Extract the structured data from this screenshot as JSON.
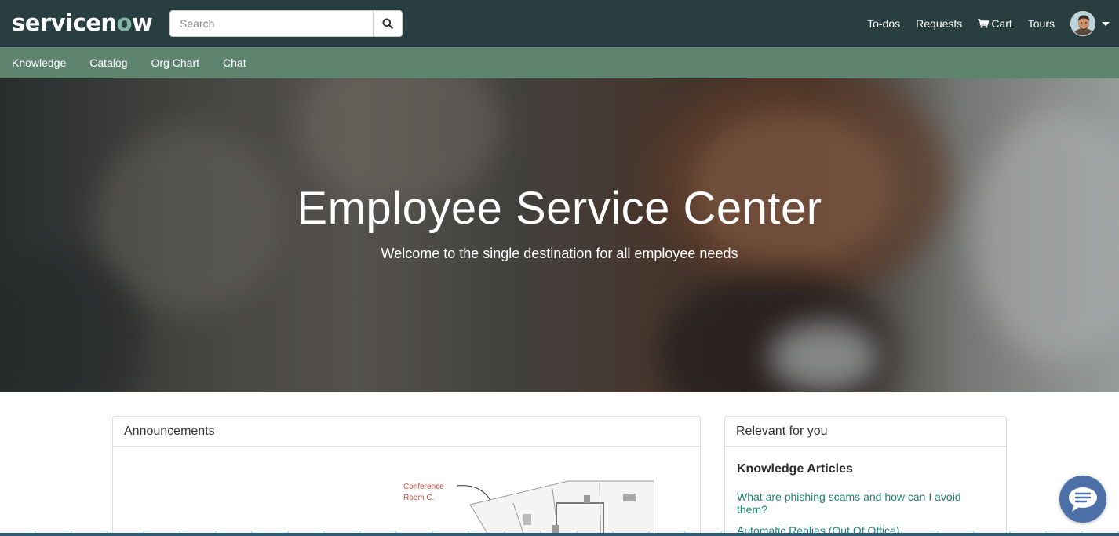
{
  "header": {
    "logo_prefix": "servicen",
    "logo_o": "o",
    "logo_suffix": "w",
    "search": {
      "placeholder": "Search",
      "value": ""
    },
    "links": {
      "todos": "To-dos",
      "requests": "Requests",
      "cart": "Cart",
      "tours": "Tours"
    },
    "icons": [
      "search-icon",
      "cart-icon",
      "chevron-down-icon"
    ]
  },
  "nav": {
    "items": [
      "Knowledge",
      "Catalog",
      "Org Chart",
      "Chat"
    ]
  },
  "hero": {
    "title": "Employee Service Center",
    "subtitle": "Welcome to the single destination for all employee needs"
  },
  "announcements": {
    "heading": "Announcements",
    "map_label_1": "Conference",
    "map_label_2": "Room C."
  },
  "relevant": {
    "heading": "Relevant for you",
    "subheading": "Knowledge Articles",
    "articles": [
      "What are phishing scams and how can I avoid them?",
      "Automatic Replies (Out Of Office)"
    ]
  },
  "colors": {
    "header_bg": "#293e40",
    "nav_bg": "#5e8470",
    "logo_accent": "#81b5a1",
    "link": "#1f8476",
    "chat_button": "#4c6fa8"
  }
}
